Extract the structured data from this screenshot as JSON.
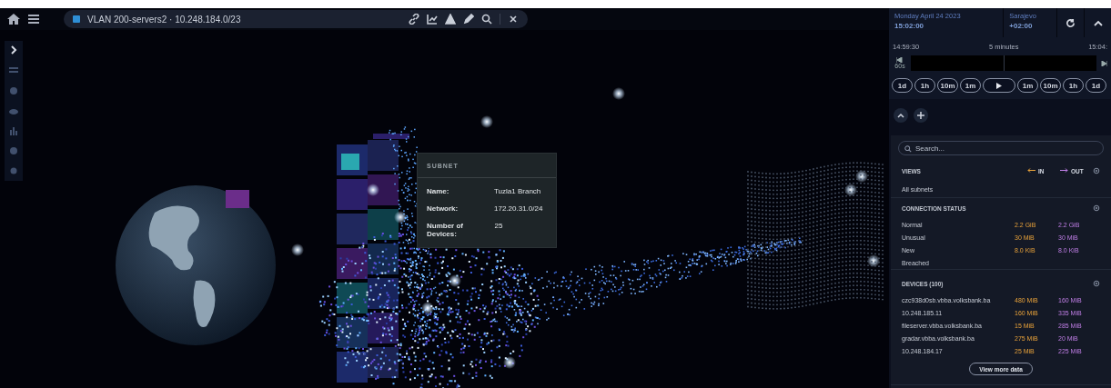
{
  "toolbar": {
    "title": "VLAN 200-servers2 · 10.248.184.0/23"
  },
  "time_panel": {
    "date": "Monday April 24 2023",
    "time": "15:02:00",
    "timezone": "Sarajevo",
    "offset": "+02:00",
    "range_start": "14:59:30",
    "range_label": "5 minutes",
    "range_end": "15:04:",
    "step_label": "60s",
    "buttons": [
      {
        "kind": "text",
        "label": "1d"
      },
      {
        "kind": "text",
        "label": "1h"
      },
      {
        "kind": "text",
        "label": "10m"
      },
      {
        "kind": "text",
        "label": "1m"
      },
      {
        "kind": "play"
      },
      {
        "kind": "text",
        "label": "1m"
      },
      {
        "kind": "text",
        "label": "10m"
      },
      {
        "kind": "text",
        "label": "1h"
      },
      {
        "kind": "text",
        "label": "1d"
      }
    ]
  },
  "tooltip": {
    "title": "SUBNET",
    "rows": [
      {
        "label": "Name:",
        "value": "Tuzla1 Branch"
      },
      {
        "label": "Network:",
        "value": "172.20.31.0/24"
      },
      {
        "label": "Number of Devices:",
        "value": "25"
      }
    ]
  },
  "panel": {
    "search": {
      "placeholder": "Search..."
    },
    "views": {
      "heading": "VIEWS",
      "in_label": "IN",
      "out_label": "OUT",
      "items": [
        "All subnets"
      ]
    },
    "connection_status": {
      "heading": "CONNECTION STATUS",
      "rows": [
        {
          "label": "Normal",
          "in": "2.2 GiB",
          "out": "2.2 GiB"
        },
        {
          "label": "Unusual",
          "in": "30 MiB",
          "out": "30 MiB"
        },
        {
          "label": "New",
          "in": "8.0 KiB",
          "out": "8.0 KiB"
        },
        {
          "label": "Breached"
        }
      ]
    },
    "devices": {
      "heading": "DEVICES (100)",
      "rows": [
        {
          "label": "czc938d0sb.vbba.volksbank.ba",
          "in": "480 MiB",
          "out": "160 MiB"
        },
        {
          "label": "10.248.185.11",
          "in": "160 MiB",
          "out": "335 MiB"
        },
        {
          "label": "fileserver.vbba.volksbank.ba",
          "in": "15 MiB",
          "out": "285 MiB"
        },
        {
          "label": "gradar.vbba.volksbank.ba",
          "in": "275 MiB",
          "out": "20 MiB"
        },
        {
          "label": "10.248.184.17",
          "in": "25 MiB",
          "out": "225 MiB"
        }
      ],
      "button": "View more data"
    }
  }
}
